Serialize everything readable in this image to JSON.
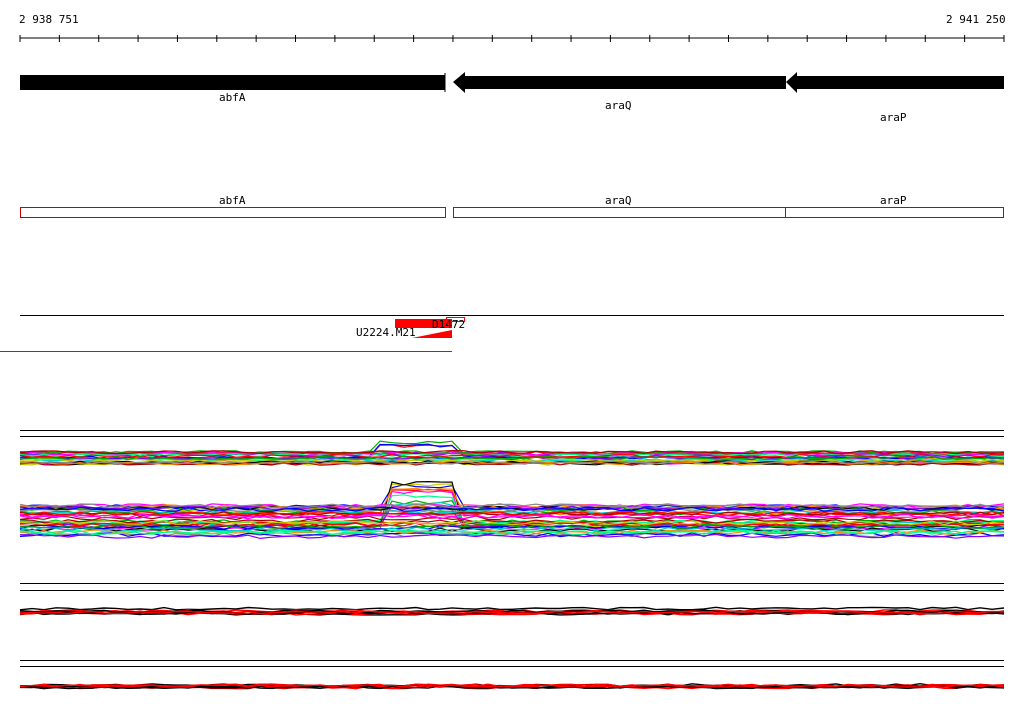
{
  "ruler": {
    "start_label": "2 938 751",
    "end_label": "2 941 250"
  },
  "genes": [
    {
      "name": "abfA",
      "strand": "+"
    },
    {
      "name": "araQ",
      "strand": "-"
    },
    {
      "name": "araP",
      "strand": "-"
    }
  ],
  "probes": [
    {
      "name": "U2224.M21",
      "color": "#ff0000"
    },
    {
      "name": "D1472",
      "color": "#ff0000"
    }
  ],
  "colors": {
    "gene_arrow": "#000000",
    "gene_box_outline": "#cc0000",
    "probe": "#ff0000",
    "profile_palette": [
      "#ff0000",
      "#00aa00",
      "#0000ff",
      "#ff00ff",
      "#00cccc",
      "#cccc00",
      "#000000",
      "#ff8800",
      "#8800ff",
      "#00ff88",
      "#888888",
      "#aa0000"
    ]
  }
}
